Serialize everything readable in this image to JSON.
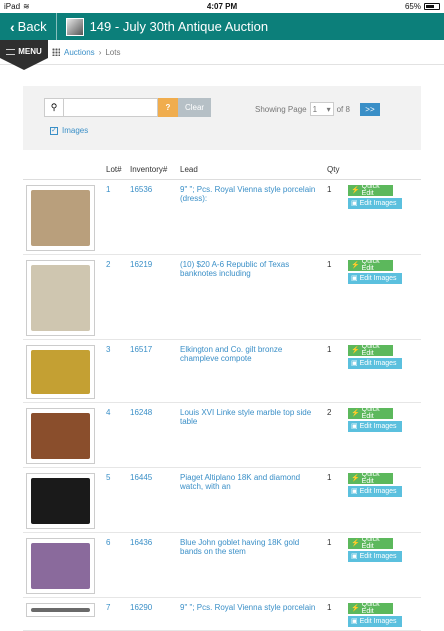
{
  "status": {
    "carrier": "iPad",
    "time": "4:07 PM",
    "battery": "65%"
  },
  "header": {
    "back_label": "Back",
    "title": "149 - July 30th Antique Auction"
  },
  "nav": {
    "menu_label": "MENU",
    "breadcrumb": [
      "Auctions",
      "Lots"
    ]
  },
  "search": {
    "placeholder": "",
    "help_label": "?",
    "clear_label": "Clear",
    "images_label": "Images",
    "images_checked": true
  },
  "pager": {
    "prefix": "Showing Page",
    "current": "1",
    "suffix": "of 8",
    "next_label": ">>"
  },
  "table": {
    "headers": [
      "",
      "Lot#",
      "Inventory#",
      "Lead",
      "Qty",
      ""
    ],
    "quick_edit_label": "Quick Edit",
    "edit_images_label": "Edit Images",
    "rows": [
      {
        "lot": "1",
        "inventory": "16536",
        "lead": "9\" \"; Pcs. Royal Vienna style porcelain (dress):",
        "qty": "1",
        "thumb_color": "#b99f7c"
      },
      {
        "lot": "2",
        "inventory": "16219",
        "lead": "(10) $20 A-6 Republic of Texas banknotes including",
        "qty": "1",
        "thumb_color": "#cfc6b0"
      },
      {
        "lot": "3",
        "inventory": "16517",
        "lead": "Elkington and Co. gilt bronze champleve compote",
        "qty": "1",
        "thumb_color": "#c4a033"
      },
      {
        "lot": "4",
        "inventory": "16248",
        "lead": "Louis XVI Linke style marble top side table",
        "qty": "2",
        "thumb_color": "#8a4e2c"
      },
      {
        "lot": "5",
        "inventory": "16445",
        "lead": "Piaget Altiplano 18K and diamond watch, with an",
        "qty": "1",
        "thumb_color": "#1a1a1a"
      },
      {
        "lot": "6",
        "inventory": "16436",
        "lead": "Blue John goblet having 18K gold bands on the stem",
        "qty": "1",
        "thumb_color": "#8a6a9c"
      },
      {
        "lot": "7",
        "inventory": "16290",
        "lead": "9\" \"; Pcs. Royal Vienna style porcelain",
        "qty": "1",
        "thumb_color": "#6a6a6a"
      }
    ]
  }
}
